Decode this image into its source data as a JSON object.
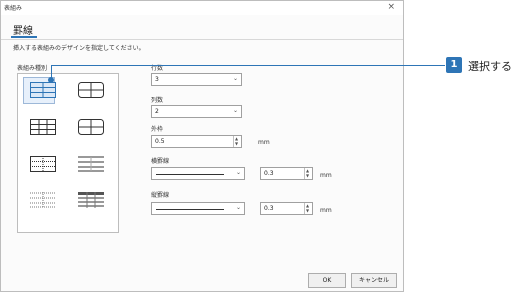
{
  "dialog": {
    "title": "表組み",
    "close_glyph": "×",
    "tab": "罫線",
    "instruction": "挿入する表組みのデザインを指定してください。",
    "design_label": "表組み種別",
    "rows": {
      "label": "行数",
      "value": "3"
    },
    "cols": {
      "label": "列数",
      "value": "2"
    },
    "frame": {
      "label": "外枠",
      "value": "0.5",
      "unit": "mm"
    },
    "hline": {
      "label": "横罫線",
      "value": "0.3",
      "unit": "mm"
    },
    "vline": {
      "label": "縦罫線",
      "value": "0.3",
      "unit": "mm"
    },
    "ok": "OK",
    "cancel": "キャンセル"
  },
  "callout": {
    "number": "1",
    "text": "選択する"
  },
  "colors": {
    "accent": "#2e75b6"
  }
}
